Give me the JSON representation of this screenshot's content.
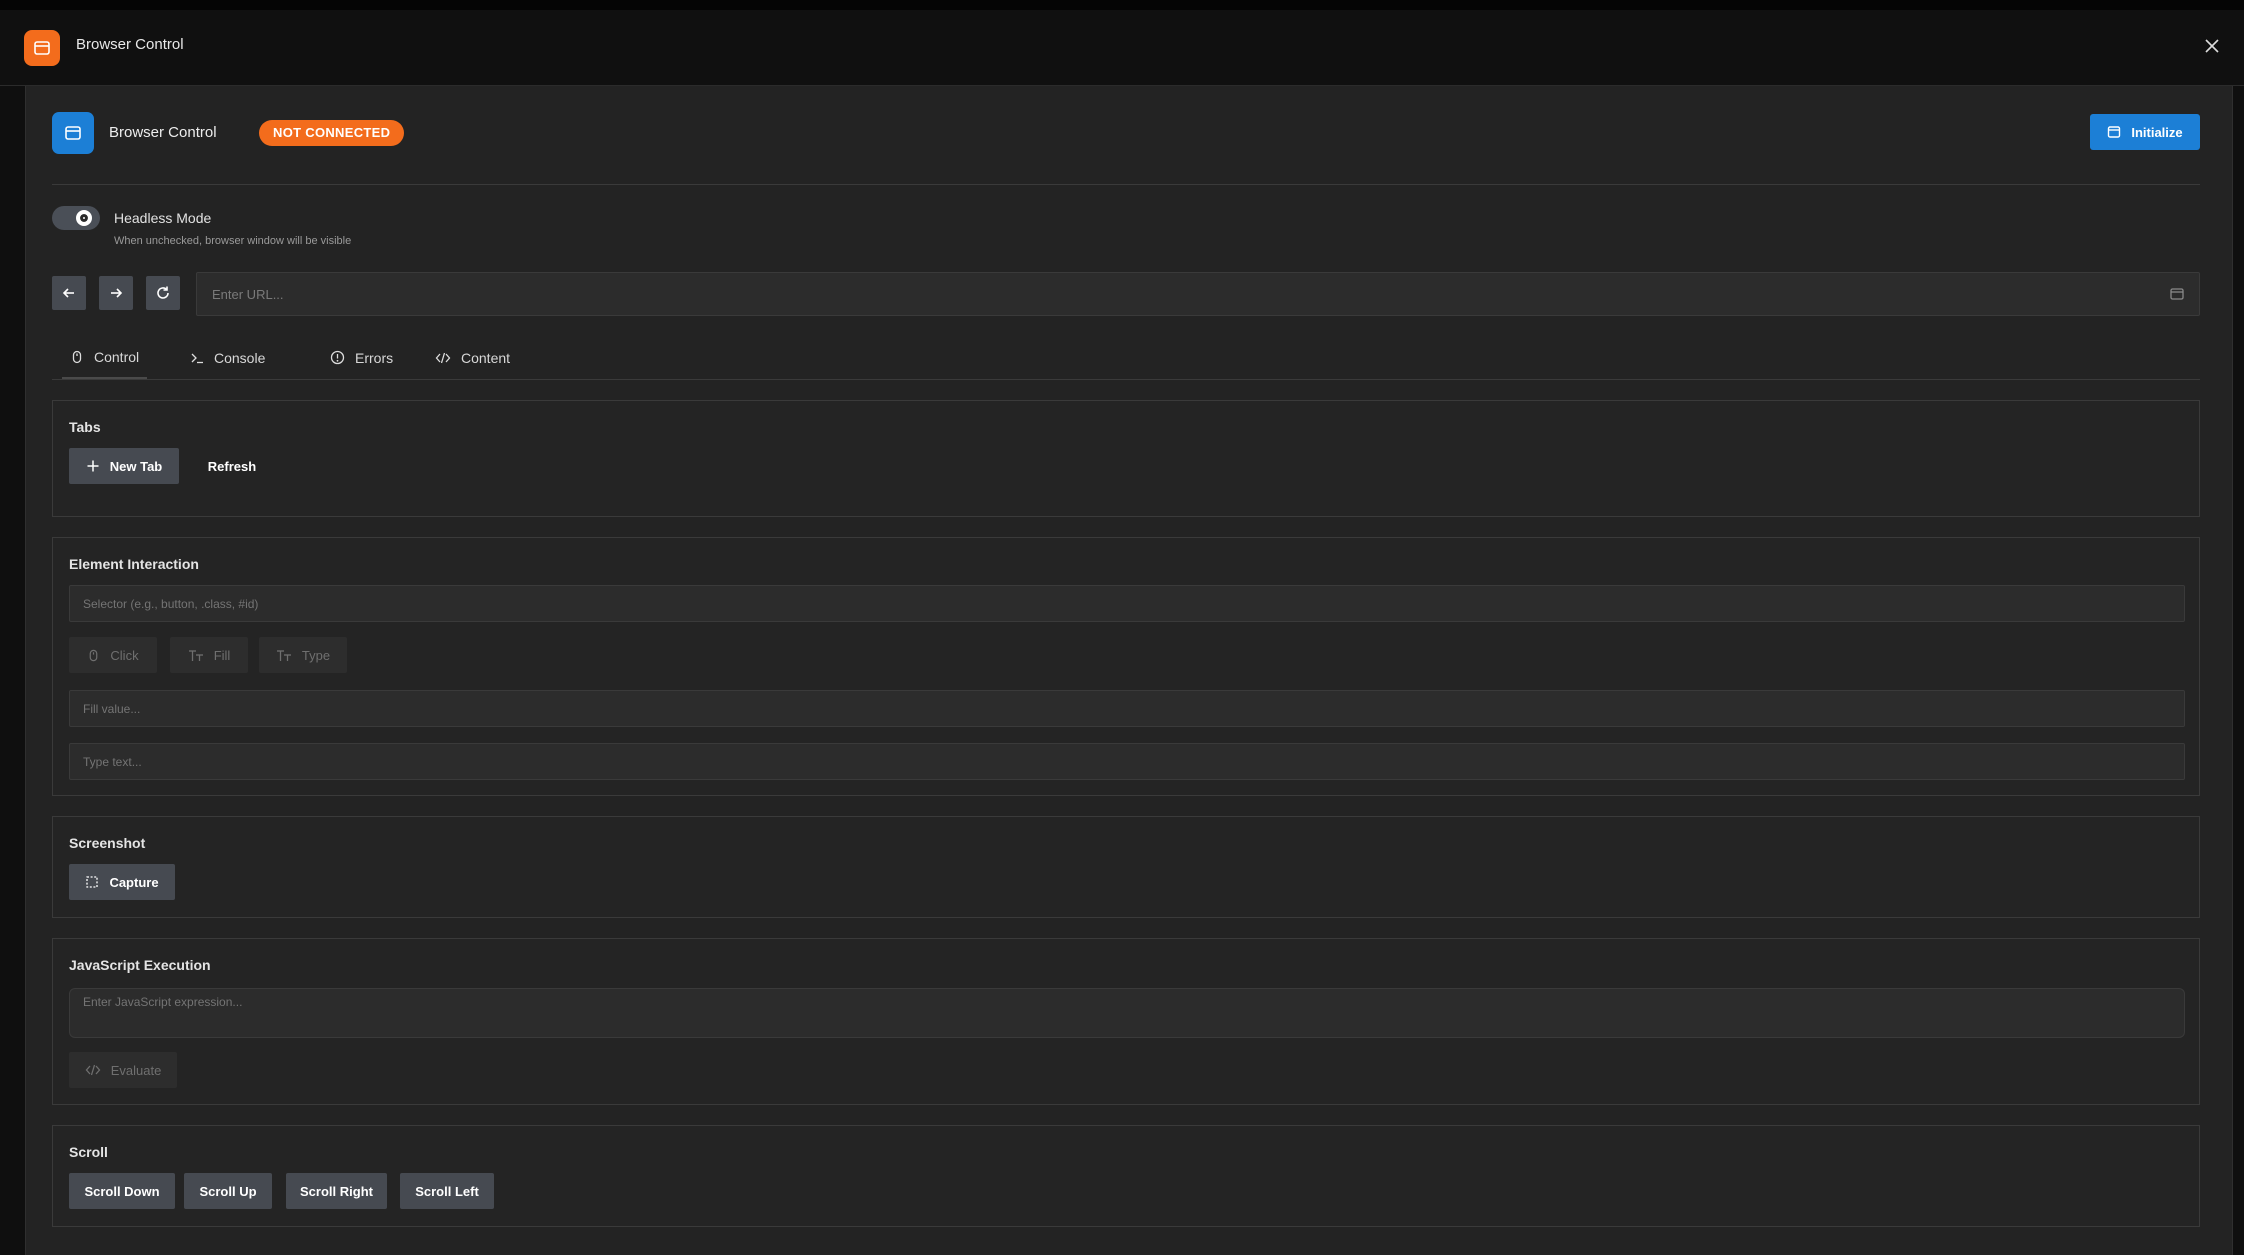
{
  "window": {
    "title": "Browser Control"
  },
  "header": {
    "title": "Browser Control",
    "status_badge": "NOT CONNECTED",
    "initialize_label": "Initialize"
  },
  "headless": {
    "label": "Headless Mode",
    "hint": "When unchecked, browser window will be visible",
    "enabled": true
  },
  "nav": {
    "url_placeholder": "Enter URL..."
  },
  "tabs": [
    {
      "label": "Control",
      "icon": "mouse-icon",
      "active": true
    },
    {
      "label": "Console",
      "icon": "terminal-icon",
      "active": false
    },
    {
      "label": "Errors",
      "icon": "alert-circle-icon",
      "active": false
    },
    {
      "label": "Content",
      "icon": "code-icon",
      "active": false
    }
  ],
  "tabs_section": {
    "title": "Tabs",
    "new_tab_label": "New Tab",
    "refresh_label": "Refresh"
  },
  "element_interaction": {
    "title": "Element Interaction",
    "selector_placeholder": "Selector (e.g., button, .class, #id)",
    "click_label": "Click",
    "fill_label": "Fill",
    "type_label": "Type",
    "fill_placeholder": "Fill value...",
    "type_placeholder": "Type text..."
  },
  "screenshot": {
    "title": "Screenshot",
    "capture_label": "Capture"
  },
  "javascript": {
    "title": "JavaScript Execution",
    "placeholder": "Enter JavaScript expression...",
    "evaluate_label": "Evaluate"
  },
  "scroll": {
    "title": "Scroll",
    "down_label": "Scroll Down",
    "up_label": "Scroll Up",
    "right_label": "Scroll Right",
    "left_label": "Scroll Left"
  },
  "colors": {
    "accent_orange": "#f36c1c",
    "accent_blue": "#1c7fd6"
  }
}
